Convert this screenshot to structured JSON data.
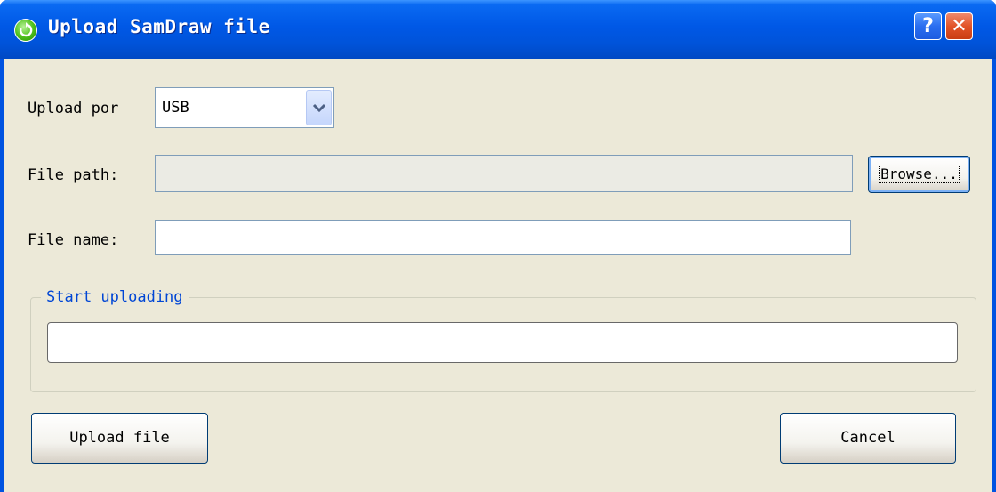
{
  "window": {
    "title": "Upload SamDraw file",
    "help_glyph": "?",
    "close_glyph": "✕",
    "icon": "refresh-icon",
    "accent_color": "#0053e1"
  },
  "form": {
    "upload_por_label": "Upload por",
    "upload_por_value": "USB",
    "file_path_label": "File path:",
    "file_path_value": "",
    "browse_label": "Browse...",
    "file_name_label": "File name:",
    "file_name_value": ""
  },
  "progress_group": {
    "title": "Start uploading",
    "progress": 0
  },
  "actions": {
    "upload_label": "Upload file",
    "cancel_label": "Cancel"
  }
}
